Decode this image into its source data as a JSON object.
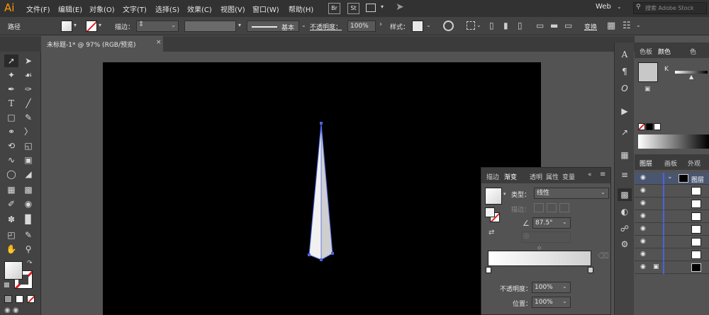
{
  "menubar": {
    "logo": "Ai",
    "items": [
      "文件(F)",
      "编辑(E)",
      "对象(O)",
      "文字(T)",
      "选择(S)",
      "效果(C)",
      "视图(V)",
      "窗口(W)",
      "帮助(H)"
    ],
    "br": "Br",
    "st": "St",
    "workspace": "Web",
    "search_placeholder": "搜索 Adobe Stock"
  },
  "control": {
    "selection_type": "路径",
    "stroke_label": "描边：",
    "stroke_style": "基本",
    "opacity_label": "不透明度：",
    "opacity_value": "100%",
    "style_label": "样式：",
    "transform_label": "变换"
  },
  "document_tab": {
    "title": "未标题-1* @ 97% (RGB/预览)"
  },
  "color_panel": {
    "tabs": [
      "色板",
      "颜色",
      "色"
    ],
    "k_label": "K"
  },
  "layers_panel": {
    "tabs": [
      "图层",
      "画板",
      "外观"
    ],
    "top_layer": "图层"
  },
  "gradient_panel": {
    "tabs": [
      "描边",
      "渐变",
      "透明",
      "属性",
      "变量"
    ],
    "type_label": "类型：",
    "type_value": "线性",
    "stroke_label": "描边：",
    "angle_value": "87.5°",
    "opacity_label": "不透明度：",
    "opacity_value": "100%",
    "position_label": "位置：",
    "position_value": "100%"
  }
}
